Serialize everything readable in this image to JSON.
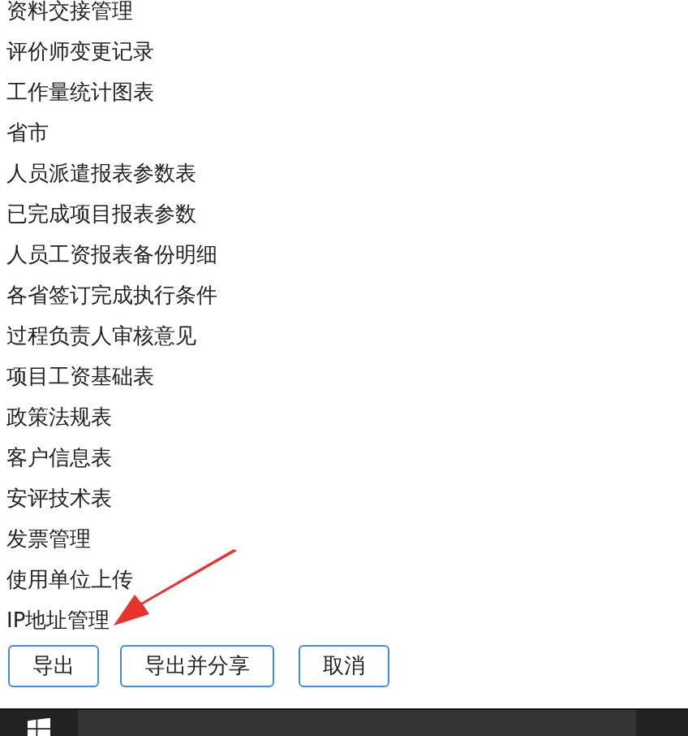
{
  "items": [
    "资料交接管理",
    "评价师变更记录",
    "工作量统计图表",
    "省市",
    "人员派遣报表参数表",
    "已完成项目报表参数",
    "人员工资报表备份明细",
    "各省签订完成执行条件",
    "过程负责人审核意见",
    "项目工资基础表",
    "政策法规表",
    "客户信息表",
    "安评技术表",
    "发票管理",
    "使用单位上传",
    "IP地址管理"
  ],
  "buttons": [
    "导出",
    "导出并分享",
    "取消"
  ]
}
